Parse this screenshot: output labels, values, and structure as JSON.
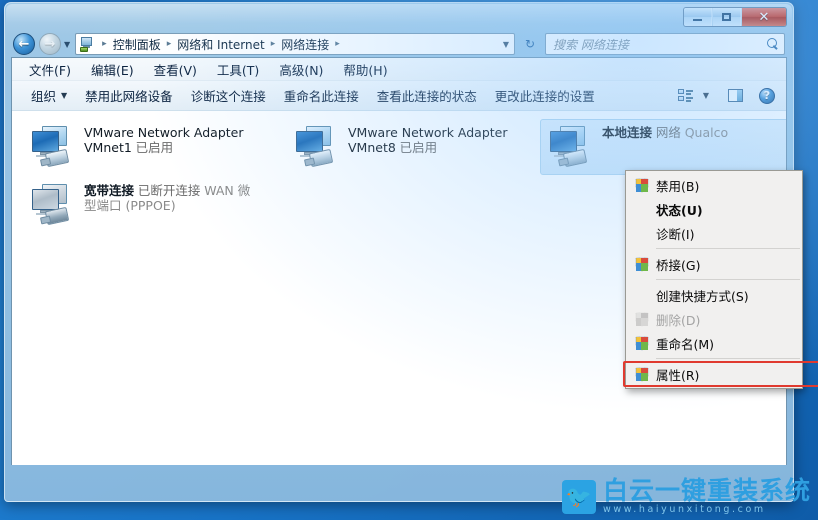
{
  "window": {
    "buttons": {
      "minimize": "minimize-button",
      "maximize": "maximize-button",
      "close_label": "✕"
    }
  },
  "address_bar": {
    "back_glyph": "←",
    "forward_glyph": "→",
    "dropdown_glyph": "▼",
    "refresh_glyph": "↻",
    "crumbs": [
      "控制面板",
      "网络和 Internet",
      "网络连接"
    ],
    "separator": "▸",
    "caret": "▼"
  },
  "search": {
    "placeholder": "搜索 网络连接",
    "icon": "search-icon"
  },
  "menubar": {
    "items": [
      {
        "label": "文件(F)"
      },
      {
        "label": "编辑(E)"
      },
      {
        "label": "查看(V)"
      },
      {
        "label": "工具(T)"
      },
      {
        "label": "高级(N)"
      },
      {
        "label": "帮助(H)"
      }
    ]
  },
  "toolbar": {
    "organize": "组织",
    "organize_caret": "▼",
    "items": [
      {
        "label": "禁用此网络设备"
      },
      {
        "label": "诊断这个连接"
      },
      {
        "label": "重命名此连接"
      },
      {
        "label": "查看此连接的状态"
      },
      {
        "label": "更改此连接的设置"
      }
    ],
    "view_caret": "▼",
    "help_glyph": "?"
  },
  "connections": [
    {
      "name": "VMware Network Adapter VMnet1",
      "sub1": "已启用",
      "sub2": "",
      "selected": false,
      "state": "enabled"
    },
    {
      "name": "VMware Network Adapter VMnet8",
      "sub1": "已启用",
      "sub2": "",
      "selected": false,
      "state": "enabled"
    },
    {
      "name": "宽带连接",
      "sub1": "已断开连接",
      "sub2": "WAN 微型端口 (PPPOE)",
      "selected": false,
      "state": "disconnected"
    },
    {
      "name": "本地连接",
      "sub1": "网络",
      "sub2": "Qualco",
      "selected": true,
      "state": "enabled"
    }
  ],
  "context_menu": {
    "items": [
      {
        "label": "禁用(B)",
        "icon": "shield-icon",
        "bold": false,
        "disabled": false,
        "highlight": false
      },
      {
        "label": "状态(U)",
        "icon": "",
        "bold": true,
        "disabled": false,
        "highlight": false
      },
      {
        "label": "诊断(I)",
        "icon": "",
        "bold": false,
        "disabled": false,
        "highlight": false
      },
      {
        "separator": true
      },
      {
        "label": "桥接(G)",
        "icon": "shield-icon",
        "bold": false,
        "disabled": false,
        "highlight": false
      },
      {
        "separator": true
      },
      {
        "label": "创建快捷方式(S)",
        "icon": "",
        "bold": false,
        "disabled": false,
        "highlight": false
      },
      {
        "label": "删除(D)",
        "icon": "shield-icon-dim",
        "bold": false,
        "disabled": true,
        "highlight": false
      },
      {
        "label": "重命名(M)",
        "icon": "shield-icon",
        "bold": false,
        "disabled": false,
        "highlight": false
      },
      {
        "separator": true
      },
      {
        "label": "属性(R)",
        "icon": "shield-icon",
        "bold": false,
        "disabled": false,
        "highlight": true
      }
    ],
    "highlight_color": "#e03a2f"
  },
  "watermark": {
    "title": "白云一键重装系统",
    "url": "www.haiyunxitong.com",
    "badge_glyph": "🐦",
    "brand_color": "#2f9fe0"
  }
}
